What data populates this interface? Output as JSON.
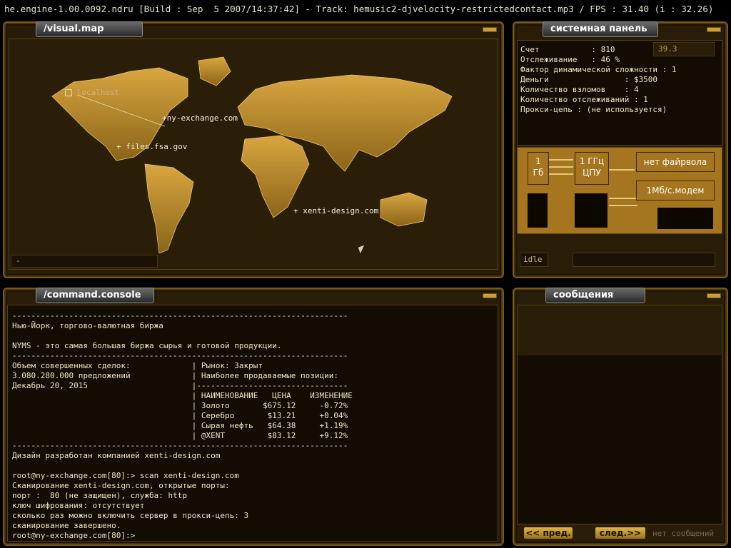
{
  "topbar": {
    "text": "he.engine-1.00.0092.ndru [Build : Sep  5 2007/14:37:42] - Track: hemusic2-djvelocity-restrictedcontact.mp3 / FPS : 31.40 (i : 32.26)"
  },
  "map": {
    "title": "/visual.map",
    "nodes": [
      {
        "label": "localhost"
      },
      {
        "label": "ny-exchange.com"
      },
      {
        "label": "files.fsa.gov"
      },
      {
        "label": "xenti-design.com"
      }
    ],
    "status": "-"
  },
  "system": {
    "title": "системная панель",
    "counter": "39.3",
    "lines": [
      "Счет           : 810",
      "Отслеживание   : 46 %",
      "Фактор динамической сложности : 1",
      "",
      "Деньги                : $3500",
      "Количество взломов    : 4",
      "Количество отслеживаний : 1",
      "",
      "Прокси-цепь : (не используется)"
    ],
    "hw": {
      "ram": "1\nГб",
      "cpu": "1 ГГц\nЦПУ",
      "firewall": "нет файрвола",
      "modem": "1Мб/с.модем"
    },
    "status": "idle"
  },
  "console": {
    "title": "/command.console",
    "text": "-----------------------------------------------------------------------\nНью-Йорк, торгово-валютная биржа\n\nNYMS - это самая большая биржа сырья и готовой продукции.\n-----------------------------------------------------------------------\nОбъем совершенных сделок:             | Рынок: Закрыт\n3.080.280.000 предложений             | Наиболее продаваемые позиции:\nДекабрь 20, 2015                      |--------------------------------\n                                      | НАИМЕНОВАНИЕ   ЦЕНА    ИЗМЕНЕНИЕ\n                                      | Золото       $675.12     -0.72%\n                                      | Серебро       $13.21     +0.04%\n                                      | Сырая нефть   $64.38     +1.19%\n                                      | @XENT         $83.12     +9.12%\n-----------------------------------------------------------------------\nДизайн разработан компанией xenti-design.com\n\nroot@ny-exchange.com[80]:> scan xenti-design.com\nСканирование xenti-design.com, открытые порты:\nпорт :  80 (не защищен), служба: http\nключ шифрования: отсутствует\nсколько раз можно включить сервер в прокси-цепь: 3\nсканирование завершено.\nroot@ny-exchange.com[80]:>"
  },
  "messages": {
    "title": "сообщения",
    "prev": "<< пред.",
    "next": "след.>>",
    "empty": "нет сообщений"
  }
}
